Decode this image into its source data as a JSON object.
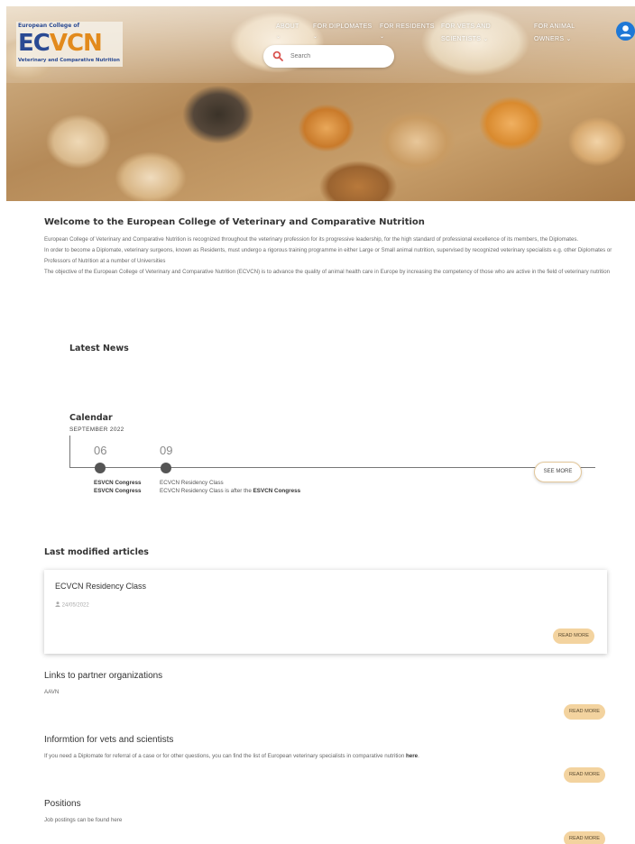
{
  "logo": {
    "top_text": "European College of",
    "ec": "EC",
    "vcn": "VCN",
    "bottom_text": "Veterinary and Comparative Nutrition"
  },
  "nav": {
    "items": [
      {
        "label": "ABOUT",
        "caret": "⌄"
      },
      {
        "label": "FOR DIPLOMATES",
        "caret": "⌄"
      },
      {
        "label": "FOR RESIDENTS",
        "caret": "⌄"
      },
      {
        "label": "FOR VETS AND",
        "label2": "SCIENTISTS ⌄"
      },
      {
        "label": "FOR ANIMAL",
        "label2": "OWNERS ⌄"
      }
    ],
    "search_placeholder": "Search"
  },
  "welcome": {
    "title": "Welcome to the European College of Veterinary and Comparative Nutrition",
    "p1": "European College of Veterinary and Comparative Nutrition is recognized throughout the veterinary profession for its progressive leadership, for the high standard of professional excellence of its members, the Diplomates.",
    "p2": "In order to become a Diplomate, veterinary surgeons, known as Residents, must undergo a rigorous training programme in either Large or Small animal nutrition, supervised by recognized veterinary specialists e.g. other Diplomates or Professors of Nutrition at a number of Universities",
    "p3": "The objective of the European College of Veterinary and Comparative Nutrition (ECVCN) is to advance the quality of animal health care in Europe by increasing the competency of those who are active in the field of veterinary nutrition"
  },
  "news": {
    "title": "Latest News"
  },
  "calendar": {
    "title": "Calendar",
    "month": "SEPTEMBER 2022",
    "events": [
      {
        "day": "06",
        "name": "ESVCN Congress",
        "desc": "ESVCN Congress"
      },
      {
        "day": "09",
        "name": "ECVCN Residency Class",
        "desc_pre": "ECVCN Residency Class is after the ",
        "desc_bold": "ESVCN Congress"
      }
    ],
    "see_more": "SEE MORE"
  },
  "last_modified": {
    "title": "Last modified articles",
    "article": {
      "title": "ECVCN Residency Class",
      "date": "24/05/2022",
      "read_more": "READ MORE"
    }
  },
  "sections": [
    {
      "title": "Links to partner organizations",
      "body": "AAVN",
      "read_more": "READ MORE"
    },
    {
      "title": "Informtion for vets and scientists",
      "body": "If you need a Diplomate for referral of a case or for other questions, you can find the list of European veterinary specialists in comparative nutrition ",
      "link": "here",
      "tail": ".",
      "read_more": "READ MORE"
    },
    {
      "title": "Positions",
      "body": "Job postings can be found here",
      "read_more": "READ MORE"
    }
  ],
  "colors": {
    "brand_blue": "#2a4a93",
    "brand_orange": "#e28a1c",
    "button_tan": "#f3d39f",
    "user_blue": "#1f78d6"
  }
}
